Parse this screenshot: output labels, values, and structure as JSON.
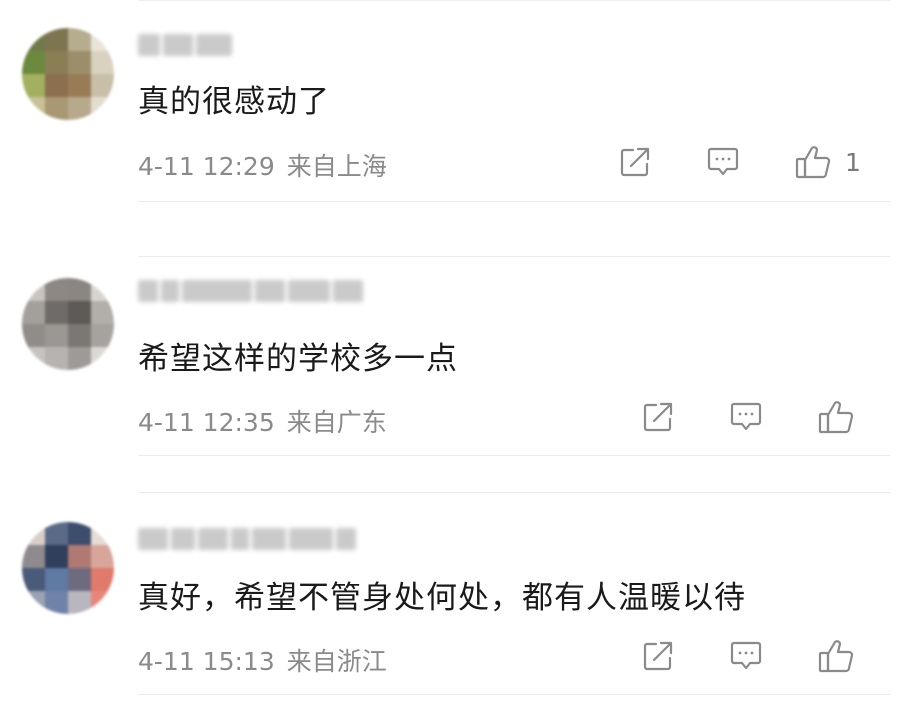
{
  "comments": [
    {
      "text": "真的很感动了",
      "date": "4-11 12:29",
      "location": "来自上海",
      "like_count": "1",
      "icons": {
        "share": "share-icon",
        "reply": "comment-icon",
        "like": "thumbs-up-icon"
      }
    },
    {
      "text": "希望这样的学校多一点",
      "date": "4-11 12:35",
      "location": "来自广东",
      "like_count": "",
      "icons": {
        "share": "share-icon",
        "reply": "comment-icon",
        "like": "thumbs-up-icon"
      }
    },
    {
      "text": "真好，希望不管身处何处，都有人温暖以待",
      "date": "4-11 15:13",
      "location": "来自浙江",
      "like_count": "",
      "icons": {
        "share": "share-icon",
        "reply": "comment-icon",
        "like": "thumbs-up-icon"
      }
    }
  ],
  "colors": {
    "text": "#1a1a1a",
    "meta": "#8a8a8a",
    "icon": "#8a8a8a",
    "divider": "#ececec"
  }
}
